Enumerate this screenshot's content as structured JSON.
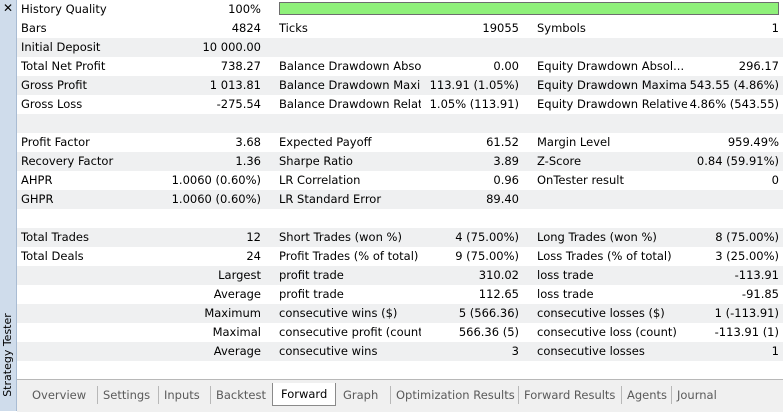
{
  "sidebar": {
    "title": "Strategy Tester",
    "close_label": "✕"
  },
  "history_quality": {
    "label": "History Quality",
    "value": "100%",
    "fill_fraction": 1.0,
    "bar_color": "#8ff07a"
  },
  "rows": [
    {
      "shade": false,
      "c1": "Bars",
      "c2": "4824",
      "c3": "Ticks",
      "c4": "19055",
      "c5": "Symbols",
      "c6": "1"
    },
    {
      "shade": true,
      "c1": "Initial Deposit",
      "c2": "10 000.00",
      "c3": "",
      "c4": "",
      "c5": "",
      "c6": ""
    },
    {
      "shade": false,
      "c1": "Total Net Profit",
      "c2": "738.27",
      "c3": "Balance Drawdown Abso...",
      "c4": "0.00",
      "c5": "Equity Drawdown Absol...",
      "c6": "296.17"
    },
    {
      "shade": true,
      "c1": "Gross Profit",
      "c2": "1 013.81",
      "c3": "Balance Drawdown Maxi...",
      "c4": "113.91 (1.05%)",
      "c5": "Equity Drawdown Maximal",
      "c6": "543.55 (4.86%)"
    },
    {
      "shade": false,
      "c1": "Gross Loss",
      "c2": "-275.54",
      "c3": "Balance Drawdown Relat...",
      "c4": "1.05% (113.91)",
      "c5": "Equity Drawdown Relative",
      "c6": "4.86% (543.55)"
    },
    {
      "shade": true,
      "c1": "",
      "c2": "",
      "c3": "",
      "c4": "",
      "c5": "",
      "c6": ""
    },
    {
      "shade": false,
      "c1": "Profit Factor",
      "c2": "3.68",
      "c3": "Expected Payoff",
      "c4": "61.52",
      "c5": "Margin Level",
      "c6": "959.49%"
    },
    {
      "shade": true,
      "c1": "Recovery Factor",
      "c2": "1.36",
      "c3": "Sharpe Ratio",
      "c4": "3.89",
      "c5": "Z-Score",
      "c6": "0.84 (59.91%)"
    },
    {
      "shade": false,
      "c1": "AHPR",
      "c2": "1.0060 (0.60%)",
      "c3": "LR Correlation",
      "c4": "0.96",
      "c5": "OnTester result",
      "c6": "0"
    },
    {
      "shade": true,
      "c1": "GHPR",
      "c2": "1.0060 (0.60%)",
      "c3": "LR Standard Error",
      "c4": "89.40",
      "c5": "",
      "c6": ""
    },
    {
      "shade": false,
      "c1": "",
      "c2": "",
      "c3": "",
      "c4": "",
      "c5": "",
      "c6": ""
    },
    {
      "shade": true,
      "c1": "Total Trades",
      "c2": "12",
      "c3": "Short Trades (won %)",
      "c4": "4 (75.00%)",
      "c5": "Long Trades (won %)",
      "c6": "8 (75.00%)"
    },
    {
      "shade": false,
      "c1": "Total Deals",
      "c2": "24",
      "c3": "Profit Trades (% of total)",
      "c4": "9 (75.00%)",
      "c5": "Loss Trades (% of total)",
      "c6": "3 (25.00%)"
    },
    {
      "shade": true,
      "right": true,
      "c1": "Largest",
      "c3": "profit trade",
      "c4": "310.02",
      "c5": "loss trade",
      "c6": "-113.91"
    },
    {
      "shade": false,
      "right": true,
      "c1": "Average",
      "c3": "profit trade",
      "c4": "112.65",
      "c5": "loss trade",
      "c6": "-91.85"
    },
    {
      "shade": true,
      "right": true,
      "c1": "Maximum",
      "c3": "consecutive wins ($)",
      "c4": "5 (566.36)",
      "c5": "consecutive losses ($)",
      "c6": "1 (-113.91)"
    },
    {
      "shade": false,
      "right": true,
      "c1": "Maximal",
      "c3": "consecutive profit (count)",
      "c4": "566.36 (5)",
      "c5": "consecutive loss (count)",
      "c6": "-113.91 (1)"
    },
    {
      "shade": true,
      "right": true,
      "c1": "Average",
      "c3": "consecutive wins",
      "c4": "3",
      "c5": "consecutive losses",
      "c6": "1"
    }
  ],
  "tabs": [
    {
      "label": "Overview",
      "active": false
    },
    {
      "label": "Settings",
      "active": false
    },
    {
      "label": "Inputs",
      "active": false
    },
    {
      "label": "Backtest",
      "active": false
    },
    {
      "label": "Forward",
      "active": true
    },
    {
      "label": "Graph",
      "active": false
    },
    {
      "label": "Optimization Results",
      "active": false
    },
    {
      "label": "Forward Results",
      "active": false
    },
    {
      "label": "Agents",
      "active": false
    },
    {
      "label": "Journal",
      "active": false
    }
  ]
}
